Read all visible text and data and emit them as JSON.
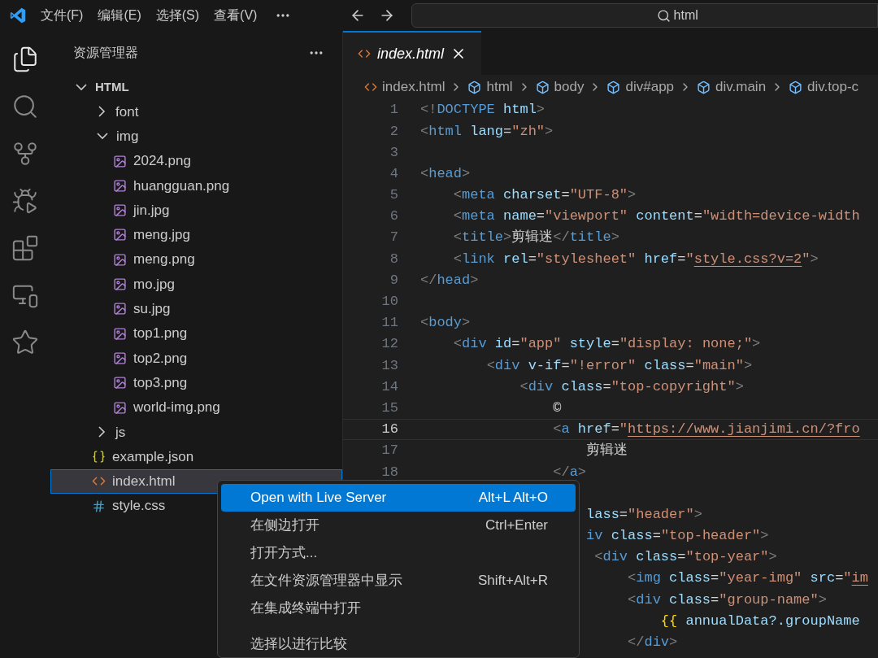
{
  "title_bar": {
    "menus": [
      "文件(F)",
      "编辑(E)",
      "选择(S)",
      "查看(V)"
    ],
    "command_center": {
      "text": "html"
    }
  },
  "activity_bar": [
    {
      "kind": "explorer",
      "selected": true
    },
    {
      "kind": "search",
      "selected": false
    },
    {
      "kind": "source-control",
      "selected": false
    },
    {
      "kind": "run",
      "selected": false
    },
    {
      "kind": "extensions",
      "selected": false
    },
    {
      "kind": "remote",
      "selected": false
    },
    {
      "kind": "star",
      "selected": false
    }
  ],
  "sidebar": {
    "title": "资源管理器",
    "tree": [
      {
        "label": "HTML",
        "kind": "root",
        "expanded": true,
        "selected": false,
        "children": [
          {
            "label": "font",
            "kind": "folder",
            "expanded": false,
            "selected": false
          },
          {
            "label": "img",
            "kind": "folder",
            "expanded": true,
            "selected": false,
            "children": [
              {
                "label": "2024.png",
                "kind": "image",
                "selected": false
              },
              {
                "label": "huangguan.png",
                "kind": "image",
                "selected": false
              },
              {
                "label": "jin.jpg",
                "kind": "image",
                "selected": false
              },
              {
                "label": "meng.jpg",
                "kind": "image",
                "selected": false
              },
              {
                "label": "meng.png",
                "kind": "image",
                "selected": false
              },
              {
                "label": "mo.jpg",
                "kind": "image",
                "selected": false
              },
              {
                "label": "su.jpg",
                "kind": "image",
                "selected": false
              },
              {
                "label": "top1.png",
                "kind": "image",
                "selected": false
              },
              {
                "label": "top2.png",
                "kind": "image",
                "selected": false
              },
              {
                "label": "top3.png",
                "kind": "image",
                "selected": false
              },
              {
                "label": "world-img.png",
                "kind": "image",
                "selected": false
              }
            ]
          },
          {
            "label": "js",
            "kind": "folder",
            "expanded": false,
            "selected": false
          },
          {
            "label": "example.json",
            "kind": "json",
            "selected": false
          },
          {
            "label": "index.html",
            "kind": "html",
            "selected": true
          },
          {
            "label": "style.css",
            "kind": "css",
            "selected": false
          }
        ]
      }
    ]
  },
  "tabs": [
    {
      "label": "index.html",
      "selected": true,
      "preview": true
    }
  ],
  "breadcrumbs": [
    {
      "kind": "file",
      "text": "index.html"
    },
    {
      "kind": "element",
      "text": "html"
    },
    {
      "kind": "element",
      "text": "body"
    },
    {
      "kind": "element",
      "text": "div#app"
    },
    {
      "kind": "element",
      "text": "div.main"
    },
    {
      "kind": "element",
      "text": "div.top-c"
    }
  ],
  "code": [
    {
      "number": "1",
      "current": false,
      "tokens": [
        {
          "kind": "punct",
          "text": "<!"
        },
        {
          "kind": "tag",
          "text": "DOCTYPE"
        },
        {
          "kind": "attr",
          "text": " html"
        },
        {
          "kind": "punct",
          "text": ">"
        }
      ]
    },
    {
      "number": "2",
      "current": false,
      "tokens": [
        {
          "kind": "punct",
          "text": "<"
        },
        {
          "kind": "tag",
          "text": "html"
        },
        {
          "kind": "attr",
          "text": " lang"
        },
        {
          "kind": "text",
          "text": "="
        },
        {
          "kind": "str",
          "text": "\"zh\""
        },
        {
          "kind": "punct",
          "text": ">"
        }
      ]
    },
    {
      "number": "3",
      "current": false
    },
    {
      "number": "4",
      "current": false,
      "tokens": [
        {
          "kind": "punct",
          "text": "<"
        },
        {
          "kind": "tag",
          "text": "head"
        },
        {
          "kind": "punct",
          "text": ">"
        }
      ]
    },
    {
      "number": "5",
      "current": false,
      "tokens": [
        {
          "kind": "punct",
          "text": "    <"
        },
        {
          "kind": "tag",
          "text": "meta"
        },
        {
          "kind": "attr",
          "text": " charset"
        },
        {
          "kind": "text",
          "text": "="
        },
        {
          "kind": "str",
          "text": "\"UTF-8\""
        },
        {
          "kind": "punct",
          "text": ">"
        }
      ]
    },
    {
      "number": "6",
      "current": false,
      "tokens": [
        {
          "kind": "punct",
          "text": "    <"
        },
        {
          "kind": "tag",
          "text": "meta"
        },
        {
          "kind": "attr",
          "text": " name"
        },
        {
          "kind": "text",
          "text": "="
        },
        {
          "kind": "str",
          "text": "\"viewport\""
        },
        {
          "kind": "attr",
          "text": " content"
        },
        {
          "kind": "text",
          "text": "="
        },
        {
          "kind": "str",
          "text": "\"width=device-width"
        }
      ]
    },
    {
      "number": "7",
      "current": false,
      "tokens": [
        {
          "kind": "punct",
          "text": "    <"
        },
        {
          "kind": "tag",
          "text": "title"
        },
        {
          "kind": "punct",
          "text": ">"
        },
        {
          "kind": "text",
          "text": "剪辑迷"
        },
        {
          "kind": "punct",
          "text": "</"
        },
        {
          "kind": "tag",
          "text": "title"
        },
        {
          "kind": "punct",
          "text": ">"
        }
      ]
    },
    {
      "number": "8",
      "current": false,
      "tokens": [
        {
          "kind": "punct",
          "text": "    <"
        },
        {
          "kind": "tag",
          "text": "link"
        },
        {
          "kind": "attr",
          "text": " rel"
        },
        {
          "kind": "text",
          "text": "="
        },
        {
          "kind": "str",
          "text": "\"stylesheet\""
        },
        {
          "kind": "attr",
          "text": " href"
        },
        {
          "kind": "text",
          "text": "="
        },
        {
          "kind": "str",
          "text": "\""
        },
        {
          "kind": "link",
          "text": "style.css?v=2"
        },
        {
          "kind": "str",
          "text": "\""
        },
        {
          "kind": "punct",
          "text": ">"
        }
      ]
    },
    {
      "number": "9",
      "current": false,
      "tokens": [
        {
          "kind": "punct",
          "text": "</"
        },
        {
          "kind": "tag",
          "text": "head"
        },
        {
          "kind": "punct",
          "text": ">"
        }
      ]
    },
    {
      "number": "10",
      "current": false
    },
    {
      "number": "11",
      "current": false,
      "tokens": [
        {
          "kind": "punct",
          "text": "<"
        },
        {
          "kind": "tag",
          "text": "body"
        },
        {
          "kind": "punct",
          "text": ">"
        }
      ]
    },
    {
      "number": "12",
      "current": false,
      "tokens": [
        {
          "kind": "punct",
          "text": "    <"
        },
        {
          "kind": "tag",
          "text": "div"
        },
        {
          "kind": "attr",
          "text": " id"
        },
        {
          "kind": "text",
          "text": "="
        },
        {
          "kind": "str",
          "text": "\"app\""
        },
        {
          "kind": "attr",
          "text": " style"
        },
        {
          "kind": "text",
          "text": "="
        },
        {
          "kind": "str",
          "text": "\"display: none;\""
        },
        {
          "kind": "punct",
          "text": ">"
        }
      ]
    },
    {
      "number": "13",
      "current": false,
      "tokens": [
        {
          "kind": "punct",
          "text": "        <"
        },
        {
          "kind": "tag",
          "text": "div"
        },
        {
          "kind": "attr",
          "text": " v-if"
        },
        {
          "kind": "text",
          "text": "="
        },
        {
          "kind": "str",
          "text": "\"!error\""
        },
        {
          "kind": "attr",
          "text": " class"
        },
        {
          "kind": "text",
          "text": "="
        },
        {
          "kind": "str",
          "text": "\"main\""
        },
        {
          "kind": "punct",
          "text": ">"
        }
      ]
    },
    {
      "number": "14",
      "current": false,
      "tokens": [
        {
          "kind": "punct",
          "text": "            <"
        },
        {
          "kind": "tag",
          "text": "div"
        },
        {
          "kind": "attr",
          "text": " class"
        },
        {
          "kind": "text",
          "text": "="
        },
        {
          "kind": "str",
          "text": "\"top-copyright\""
        },
        {
          "kind": "punct",
          "text": ">"
        }
      ]
    },
    {
      "number": "15",
      "current": false,
      "tokens": [
        {
          "kind": "text",
          "text": "                ©"
        }
      ]
    },
    {
      "number": "16",
      "current": true,
      "tokens": [
        {
          "kind": "punct",
          "text": "                <"
        },
        {
          "kind": "tag",
          "text": "a"
        },
        {
          "kind": "attr",
          "text": " href"
        },
        {
          "kind": "text",
          "text": "="
        },
        {
          "kind": "str",
          "text": "\""
        },
        {
          "kind": "link",
          "text": "https://www.jianjimi.cn/?fro"
        }
      ]
    },
    {
      "number": "17",
      "current": false,
      "tokens": [
        {
          "kind": "text",
          "text": "                    剪辑迷"
        }
      ]
    },
    {
      "number": "18",
      "current": false,
      "tokens": [
        {
          "kind": "punct",
          "text": "                </"
        },
        {
          "kind": "tag",
          "text": "a"
        },
        {
          "kind": "punct",
          "text": ">"
        }
      ]
    },
    {
      "current": false
    },
    {
      "tokens": [
        {
          "kind": "attr",
          "text": "                    lass"
        },
        {
          "kind": "text",
          "text": "="
        },
        {
          "kind": "str",
          "text": "\"header\""
        },
        {
          "kind": "punct",
          "text": ">"
        }
      ]
    },
    {
      "tokens": [
        {
          "kind": "tag",
          "text": "                    iv"
        },
        {
          "kind": "attr",
          "text": " class"
        },
        {
          "kind": "text",
          "text": "="
        },
        {
          "kind": "str",
          "text": "\"top-header\""
        },
        {
          "kind": "punct",
          "text": ">"
        }
      ]
    },
    {
      "tokens": [
        {
          "kind": "punct",
          "text": "                     <"
        },
        {
          "kind": "tag",
          "text": "div"
        },
        {
          "kind": "attr",
          "text": " class"
        },
        {
          "kind": "text",
          "text": "="
        },
        {
          "kind": "str",
          "text": "\"top-year\""
        },
        {
          "kind": "punct",
          "text": ">"
        }
      ]
    },
    {
      "tokens": [
        {
          "kind": "punct",
          "text": "                         <"
        },
        {
          "kind": "tag",
          "text": "img"
        },
        {
          "kind": "attr",
          "text": " class"
        },
        {
          "kind": "text",
          "text": "="
        },
        {
          "kind": "str",
          "text": "\"year-img\""
        },
        {
          "kind": "attr",
          "text": " src"
        },
        {
          "kind": "text",
          "text": "="
        },
        {
          "kind": "str",
          "text": "\""
        },
        {
          "kind": "link",
          "text": "im"
        }
      ]
    },
    {
      "tokens": [
        {
          "kind": "punct",
          "text": "                         <"
        },
        {
          "kind": "tag",
          "text": "div"
        },
        {
          "kind": "attr",
          "text": " class"
        },
        {
          "kind": "text",
          "text": "="
        },
        {
          "kind": "str",
          "text": "\"group-name\""
        },
        {
          "kind": "punct",
          "text": ">"
        }
      ]
    },
    {
      "tokens": [
        {
          "kind": "brace",
          "text": "                             {{"
        },
        {
          "kind": "attr",
          "text": " annualData?.groupName"
        }
      ]
    },
    {
      "tokens": [
        {
          "kind": "punct",
          "text": "                         </"
        },
        {
          "kind": "tag",
          "text": "div"
        },
        {
          "kind": "punct",
          "text": ">"
        }
      ]
    }
  ],
  "context_menu": [
    {
      "kind": "item",
      "label": "Open with Live Server",
      "shortcut": "Alt+L Alt+O",
      "selected": true
    },
    {
      "kind": "item",
      "label": "在侧边打开",
      "shortcut": "Ctrl+Enter",
      "selected": false
    },
    {
      "kind": "item",
      "label": "打开方式...",
      "selected": false
    },
    {
      "kind": "item",
      "label": "在文件资源管理器中显示",
      "shortcut": "Shift+Alt+R",
      "selected": false
    },
    {
      "kind": "item",
      "label": "在集成终端中打开",
      "selected": false
    },
    {
      "kind": "separator"
    },
    {
      "kind": "item",
      "label": "选择以进行比较",
      "selected": false
    }
  ]
}
